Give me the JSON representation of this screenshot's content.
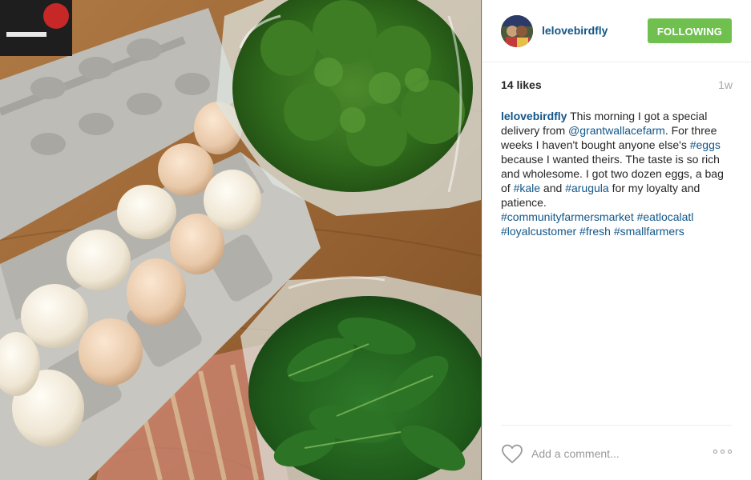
{
  "post": {
    "username": "lelovebirdfly",
    "follow_label": "FOLLOWING",
    "likes": "14 likes",
    "age": "1w",
    "photo_alt": "eggs-kale-arugula-photo"
  },
  "caption": {
    "username": "lelovebirdfly",
    "t1": " This morning I got a special delivery from ",
    "mention": "@grantwallacefarm",
    "t2": ". For three weeks I haven't bought anyone else's ",
    "tag_eggs": "#eggs",
    "t3": " because I wanted theirs. The taste is so rich and wholesome. I got two dozen eggs, a bag of ",
    "tag_kale": "#kale",
    "t4": " and ",
    "tag_arugula": "#arugula",
    "t5": " for my loyalty and patience.",
    "tag_cfm": "#communityfarmersmarket",
    "tag_eat": "#eatlocalatl",
    "tag_loyal": "#loyalcustomer",
    "tag_fresh": "#fresh",
    "tag_small": "#smallfarmers"
  },
  "comment": {
    "placeholder": "Add a comment..."
  },
  "colors": {
    "link": "#125688",
    "follow_bg": "#70c050",
    "muted": "#a5a7aa"
  },
  "icons": {
    "like": "heart-outline-icon",
    "more": "ellipsis-icon"
  }
}
